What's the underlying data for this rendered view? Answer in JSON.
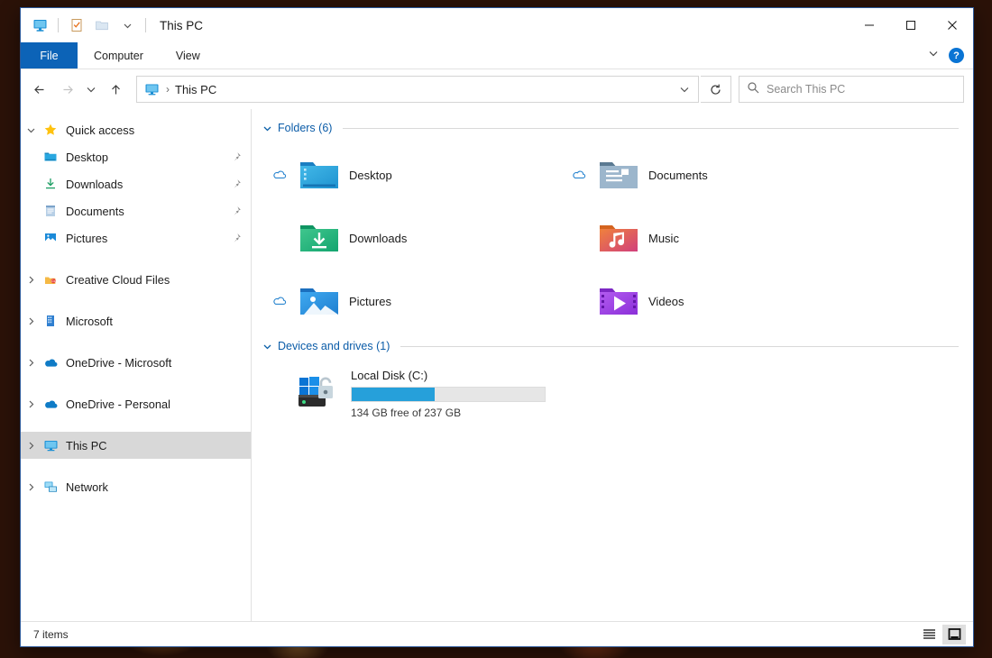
{
  "window": {
    "title": "This PC",
    "quick_access_toolbar": [
      {
        "name": "this-pc-icon",
        "label": "This PC"
      },
      {
        "name": "properties-icon",
        "label": "Properties"
      },
      {
        "name": "new-folder-icon",
        "label": "New folder"
      },
      {
        "name": "customize-dropdown-icon",
        "label": "Customize Quick Access Toolbar"
      }
    ],
    "controls": {
      "minimize": "─",
      "maximize": "☐",
      "close": "✕"
    }
  },
  "ribbon": {
    "tabs": [
      {
        "label": "File",
        "active": true
      },
      {
        "label": "Computer",
        "active": false
      },
      {
        "label": "View",
        "active": false
      }
    ],
    "collapse_label": "⌄",
    "help_label": "?"
  },
  "nav": {
    "back_label": "←",
    "forward_label": "→",
    "recent_label": "⌄",
    "up_label": "↑",
    "breadcrumb_separator": "›",
    "breadcrumb_text": "This PC",
    "address_dropdown_label": "⌄",
    "refresh_label": "↻"
  },
  "search": {
    "placeholder": "Search This PC",
    "value": ""
  },
  "sidebar": {
    "items": [
      {
        "label": "Quick access",
        "icon": "star-icon",
        "chevron": "expanded",
        "indent": false,
        "pin": false,
        "selected": false
      },
      {
        "label": "Desktop",
        "icon": "desktop-folder-icon",
        "chevron": "none",
        "indent": true,
        "pin": true,
        "selected": false
      },
      {
        "label": "Downloads",
        "icon": "downloads-arrow-icon",
        "chevron": "none",
        "indent": true,
        "pin": true,
        "selected": false
      },
      {
        "label": "Documents",
        "icon": "documents-folder-icon",
        "chevron": "none",
        "indent": true,
        "pin": true,
        "selected": false
      },
      {
        "label": "Pictures",
        "icon": "pictures-folder-icon",
        "chevron": "none",
        "indent": true,
        "pin": true,
        "selected": false
      },
      {
        "label": "Creative Cloud Files",
        "icon": "creative-cloud-icon",
        "chevron": "collapsed",
        "indent": false,
        "pin": false,
        "selected": false
      },
      {
        "label": "Microsoft",
        "icon": "sharepoint-icon",
        "chevron": "collapsed",
        "indent": false,
        "pin": false,
        "selected": false
      },
      {
        "label": "OneDrive - Microsoft",
        "icon": "onedrive-cloud-icon",
        "chevron": "collapsed",
        "indent": false,
        "pin": false,
        "selected": false
      },
      {
        "label": "OneDrive - Personal",
        "icon": "onedrive-cloud-icon",
        "chevron": "collapsed",
        "indent": false,
        "pin": false,
        "selected": false
      },
      {
        "label": "This PC",
        "icon": "this-pc-icon",
        "chevron": "collapsed",
        "indent": false,
        "pin": false,
        "selected": true
      },
      {
        "label": "Network",
        "icon": "network-icon",
        "chevron": "collapsed",
        "indent": false,
        "pin": false,
        "selected": false
      }
    ]
  },
  "main": {
    "folders_group": {
      "title": "Folders (6)",
      "chevron": "expanded",
      "items": [
        {
          "label": "Desktop",
          "icon": "desktop-folder-icon",
          "cloud": true
        },
        {
          "label": "Documents",
          "icon": "documents-folder-icon",
          "cloud": true
        },
        {
          "label": "Downloads",
          "icon": "downloads-folder-icon",
          "cloud": false
        },
        {
          "label": "Music",
          "icon": "music-folder-icon",
          "cloud": false
        },
        {
          "label": "Pictures",
          "icon": "pictures-folder-icon",
          "cloud": true
        },
        {
          "label": "Videos",
          "icon": "videos-folder-icon",
          "cloud": false
        }
      ]
    },
    "drives_group": {
      "title": "Devices and drives (1)",
      "chevron": "expanded",
      "items": [
        {
          "label": "Local Disk (C:)",
          "icon": "local-disk-bitlocker-icon",
          "capacity_text": "134 GB free of 237 GB",
          "used_percent": 43,
          "bar_color": "#26a0da"
        }
      ]
    }
  },
  "status": {
    "item_count": "7 items",
    "views": [
      {
        "name": "details-view",
        "label": "≡",
        "active": false
      },
      {
        "name": "large-icons-view",
        "label": "□",
        "active": true
      }
    ]
  }
}
